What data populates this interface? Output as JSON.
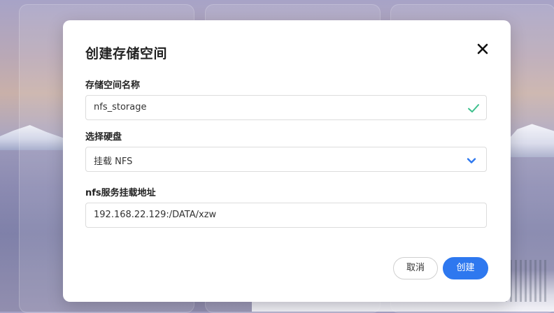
{
  "dialog": {
    "title": "创建存储空间",
    "close_icon": "close-icon",
    "name_field": {
      "label": "存储空间名称",
      "value": "nfs_storage",
      "status_icon": "check-icon"
    },
    "disk_field": {
      "label": "选择硬盘",
      "value": "挂载 NFS",
      "dropdown_icon": "chevron-down-icon"
    },
    "nfs_field": {
      "label": "nfs服务挂载地址",
      "value": "192.168.22.129:/DATA/xzw"
    },
    "buttons": {
      "cancel_label": "取消",
      "create_label": "创建"
    }
  },
  "colors": {
    "primary": "#2e78ef",
    "valid_check": "#3cc08c",
    "chevron": "#2e78ef"
  }
}
